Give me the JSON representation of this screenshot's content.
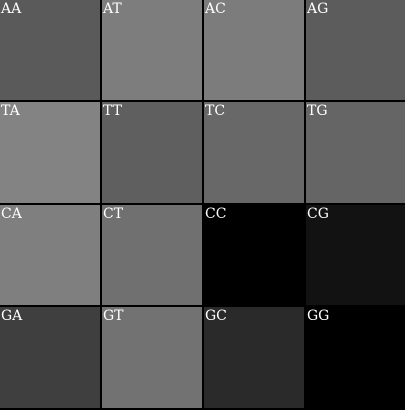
{
  "grid": {
    "cells": [
      {
        "label": "AA",
        "color": "#5a5a5a"
      },
      {
        "label": "AT",
        "color": "#7d7d7d"
      },
      {
        "label": "AC",
        "color": "#7c7c7c"
      },
      {
        "label": "AG",
        "color": "#5c5c5c"
      },
      {
        "label": "TA",
        "color": "#838383"
      },
      {
        "label": "TT",
        "color": "#5f5f5f"
      },
      {
        "label": "TC",
        "color": "#686868"
      },
      {
        "label": "TG",
        "color": "#656565"
      },
      {
        "label": "CA",
        "color": "#7f7f7f"
      },
      {
        "label": "CT",
        "color": "#707070"
      },
      {
        "label": "CC",
        "color": "#000000"
      },
      {
        "label": "CG",
        "color": "#121212"
      },
      {
        "label": "GA",
        "color": "#3f3f3f"
      },
      {
        "label": "GT",
        "color": "#727272"
      },
      {
        "label": "GC",
        "color": "#2a2a2a"
      },
      {
        "label": "GG",
        "color": "#000000"
      }
    ]
  }
}
